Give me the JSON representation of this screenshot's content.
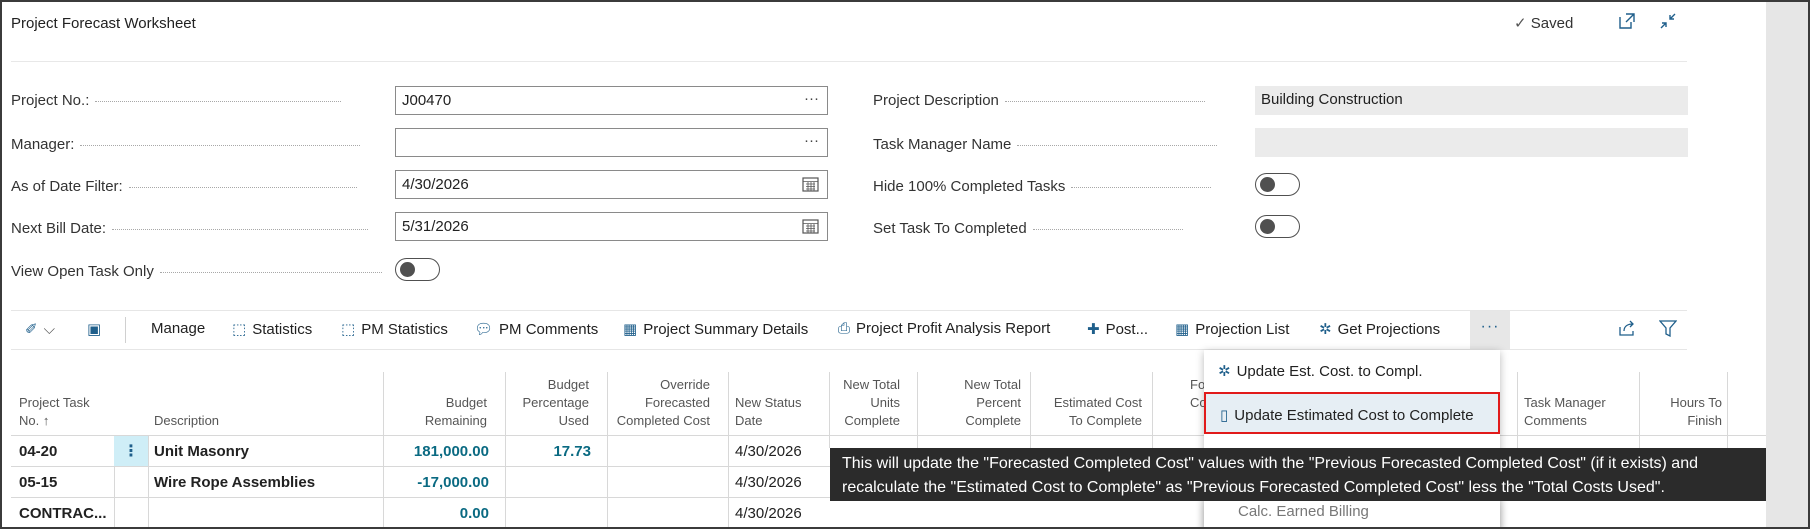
{
  "header": {
    "title": "Project Forecast Worksheet",
    "saved_label": "Saved",
    "open_new_icon": "open-in-new-window-icon",
    "collapse_icon": "collapse-icon"
  },
  "fields": {
    "project_no": {
      "label": "Project No.:",
      "value": "J00470"
    },
    "manager": {
      "label": "Manager:",
      "value": ""
    },
    "as_of_date": {
      "label": "As of Date Filter:",
      "value": "4/30/2026"
    },
    "next_bill_date": {
      "label": "Next Bill Date:",
      "value": "5/31/2026"
    },
    "view_open_task": {
      "label": "View Open Task Only",
      "value": false
    },
    "project_description": {
      "label": "Project Description",
      "value": "Building Construction"
    },
    "task_manager_name": {
      "label": "Task Manager Name",
      "value": ""
    },
    "hide_completed": {
      "label": "Hide 100% Completed Tasks",
      "value": false
    },
    "set_completed": {
      "label": "Set Task To Completed",
      "value": false
    },
    "lookup_glyph": "···"
  },
  "toolbar": {
    "items": [
      {
        "label": "Manage"
      },
      {
        "label": "Statistics",
        "icon": "statistics-icon"
      },
      {
        "label": "PM Statistics",
        "icon": "statistics-icon"
      },
      {
        "label": "PM Comments",
        "icon": "comment-icon"
      },
      {
        "label": "Project Summary Details",
        "icon": "table-icon"
      },
      {
        "label": "Project Profit Analysis Report",
        "icon": "printer-icon"
      },
      {
        "label": "Post...",
        "icon": "post-icon"
      },
      {
        "label": "Projection List",
        "icon": "table-icon"
      },
      {
        "label": "Get Projections",
        "icon": "gear-icon"
      }
    ],
    "more_label": "···"
  },
  "table": {
    "headers": {
      "task_no": [
        "Project Task",
        "No. ↑"
      ],
      "description": [
        "Description"
      ],
      "budget_remaining": [
        "Budget",
        "Remaining"
      ],
      "budget_pct": [
        "Budget",
        "Percentage",
        "Used"
      ],
      "override": [
        "Override",
        "Forecasted",
        "Completed Cost"
      ],
      "new_status_date": [
        "New Status",
        "Date"
      ],
      "new_total_units": [
        "New Total",
        "Units",
        "Complete"
      ],
      "new_total_percent": [
        "New Total",
        "Percent",
        "Complete"
      ],
      "est_cost": [
        "Estimated Cost",
        "To Complete"
      ],
      "fo_partial": [
        "Fo",
        "Co"
      ],
      "task_mgr_comments": [
        "Task Manager",
        "Comments"
      ],
      "hours_to_finish": [
        "Hours To",
        "Finish"
      ]
    },
    "rows": [
      {
        "task_no": "04-20",
        "description": "Unit Masonry",
        "budget_remaining": "181,000.00",
        "budget_pct": "17.73",
        "new_status_date": "4/30/2026"
      },
      {
        "task_no": "05-15",
        "description": "Wire Rope Assemblies",
        "budget_remaining": "-17,000.00",
        "budget_pct": "",
        "new_status_date": "4/30/2026"
      },
      {
        "task_no": "CONTRAC...",
        "description": "",
        "budget_remaining": "0.00",
        "budget_pct": "",
        "new_status_date": "4/30/2026"
      }
    ],
    "row_menu_glyph": "⋮"
  },
  "dropdown": {
    "items": [
      {
        "label": "Update Est. Cost. to Compl.",
        "icon": "update-icon"
      },
      {
        "label": "Update Estimated Cost to Complete",
        "icon": "document-icon"
      }
    ],
    "partial_item": "Calc. Earned Billing"
  },
  "tooltip": {
    "line1": "This will update the \"Forecasted Completed Cost\" values with the \"Previous Forecasted Completed Cost\" (if it exists) and",
    "line2": "recalculate the \"Estimated Cost to Complete\" as \"Previous Forecasted Completed Cost\" less the \"Total Costs Used\"."
  },
  "colors": {
    "accent": "#1f5f8b",
    "value_teal": "#0a6a82",
    "highlight_border": "#e11a1a",
    "tooltip_bg": "#2b2b2b"
  }
}
